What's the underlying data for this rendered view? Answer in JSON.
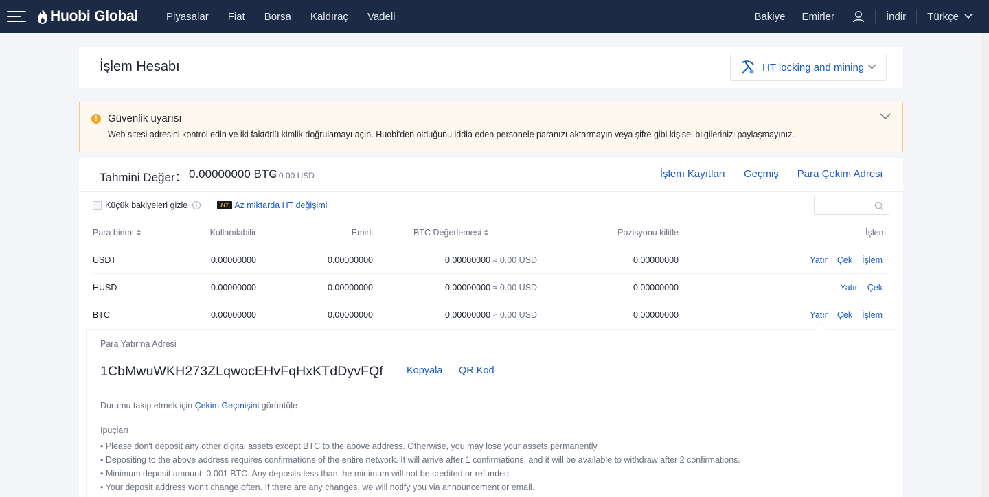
{
  "navbar": {
    "logo_main": "Huobi",
    "logo_accent": "Global",
    "links": [
      "Piyasalar",
      "Fiat",
      "Borsa",
      "Kaldıraç",
      "Vadeli"
    ],
    "balance": "Bakiye",
    "orders": "Emirler",
    "download": "İndir",
    "language": "Türkçe"
  },
  "header": {
    "title": "İşlem Hesabı",
    "ht_select_label": "HT locking and mining"
  },
  "warning": {
    "title": "Güvenlik uyarısı",
    "text": "Web sitesi adresini kontrol edin ve iki faktörlü kimlik doğrulamayı açın. Huobi'den olduğunu iddia eden personele paranızı aktarmayın veya şifre gibi kişisel bilgilerinizi paylaşmayınız."
  },
  "summary": {
    "label": "Tahmini Değer：",
    "value": "0.00000000 BTC",
    "usd": "≈ 0.00 USD",
    "links": [
      "İşlem Kayıtları",
      "Geçmiş",
      "Para Çekim Adresi"
    ]
  },
  "filters": {
    "hide_small": "Küçük bakiyeleri gizle",
    "ht_badge": "HT",
    "ht_exchange": "Az miktarda HT değişimi",
    "search_placeholder": ""
  },
  "table": {
    "headers": {
      "currency": "Para birimi",
      "available": "Kullanılabilir",
      "ordered": "Emirli",
      "btc_value": "BTC Değerlemesi",
      "locked": "Pozisyonu kilitle",
      "action": "İşlem"
    },
    "rows": [
      {
        "currency": "USDT",
        "available": "0.00000000",
        "ordered": "0.00000000",
        "btc": "0.00000000",
        "usd": "≈ 0.00 USD",
        "locked": "0.00000000",
        "actions": [
          "Yatır",
          "Çek",
          "İşlem"
        ]
      },
      {
        "currency": "HUSD",
        "available": "0.00000000",
        "ordered": "0.00000000",
        "btc": "0.00000000",
        "usd": "≈ 0.00 USD",
        "locked": "0.00000000",
        "actions": [
          "Yatır",
          "Çek"
        ]
      },
      {
        "currency": "BTC",
        "available": "0.00000000",
        "ordered": "0.00000000",
        "btc": "0.00000000",
        "usd": "≈ 0.00 USD",
        "locked": "0.00000000",
        "actions": [
          "Yatır",
          "Çek",
          "İşlem"
        ]
      }
    ]
  },
  "deposit": {
    "label": "Para Yatırma Adresi",
    "address": "1CbMwuWKH273ZLqwocEHvFqHxKTdDyvFQf",
    "copy": "Kopyala",
    "qr": "QR Kod",
    "status_prefix": "Durumu takip etmek için ",
    "status_link": "Çekim Geçmişini",
    "status_suffix": " görüntüle",
    "tips_title": "İpuçları",
    "tips": [
      "• Please don't deposit any other digital assets except BTC to the above address. Otherwise, you may lose your assets permanently.",
      "• Depositing to the above address requires confirmations of the entire network. It will arrive after 1 confirmations, and it will be available to withdraw after 2 confirmations.",
      "• Minimum deposit amount: 0.001 BTC. Any deposits less than the minimum will not be credited or refunded.",
      "• Your deposit address won't change often. If there are any changes, we will notify you via announcement or email."
    ]
  },
  "colors": {
    "navbar_bg": "#1c2a45",
    "link_blue": "#1a5bc4",
    "warning_bg": "#fef8ee",
    "warning_icon": "#f5a623"
  }
}
